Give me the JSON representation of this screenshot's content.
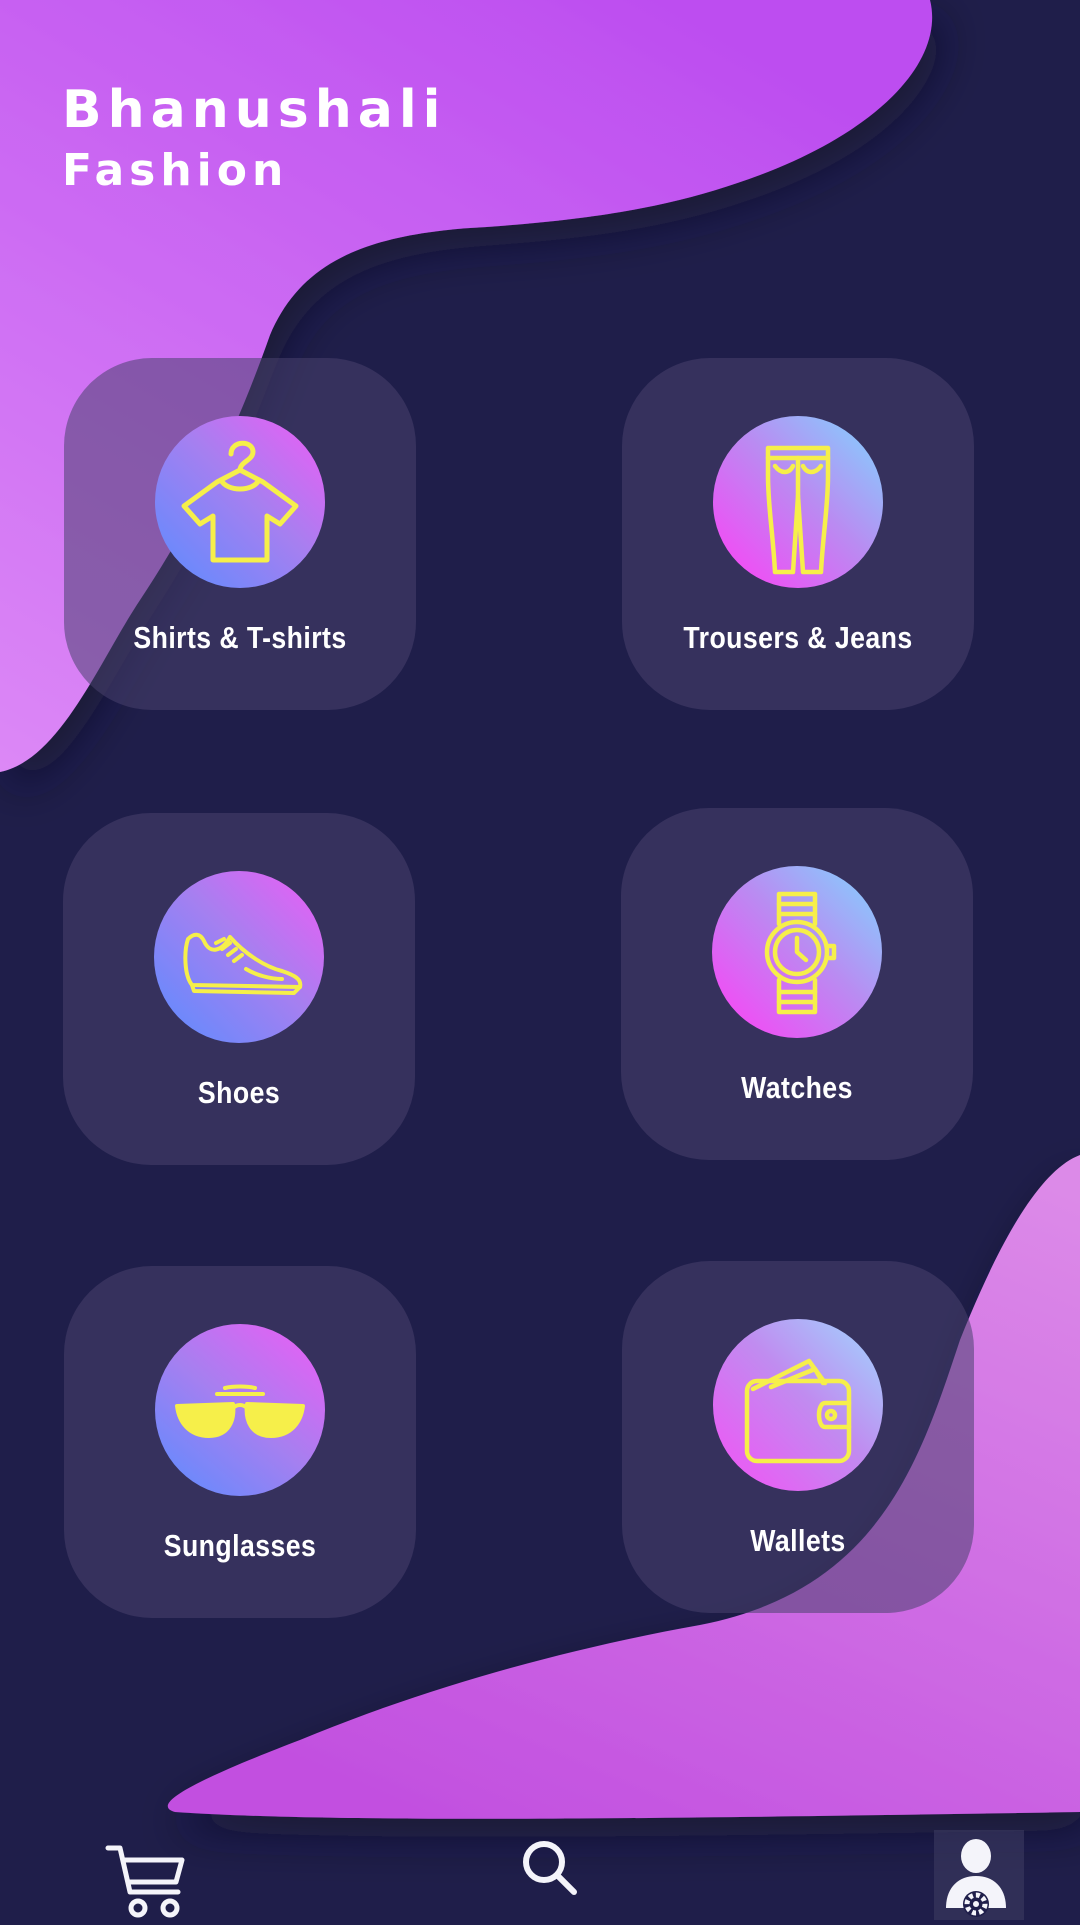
{
  "app": {
    "brand_line1": "Bhanushali",
    "brand_line2": "Fashion"
  },
  "colors": {
    "background": "#1f1e4a",
    "accent_purple": "#c04ff0",
    "accent_pink": "#d787ea",
    "icon_yellow": "#f6ef4a",
    "text": "#ffffff"
  },
  "categories": [
    {
      "label": "Shirts & T-shirts",
      "icon": "hanger-shirt-icon"
    },
    {
      "label": "Trousers & Jeans",
      "icon": "trousers-icon"
    },
    {
      "label": "Shoes",
      "icon": "sneaker-icon"
    },
    {
      "label": "Watches",
      "icon": "wristwatch-icon"
    },
    {
      "label": "Sunglasses",
      "icon": "sunglasses-icon"
    },
    {
      "label": "Wallets",
      "icon": "wallet-icon"
    }
  ],
  "navbar": {
    "items": [
      {
        "icon": "cart-icon"
      },
      {
        "icon": "search-icon"
      },
      {
        "icon": "user-settings-icon"
      }
    ]
  }
}
